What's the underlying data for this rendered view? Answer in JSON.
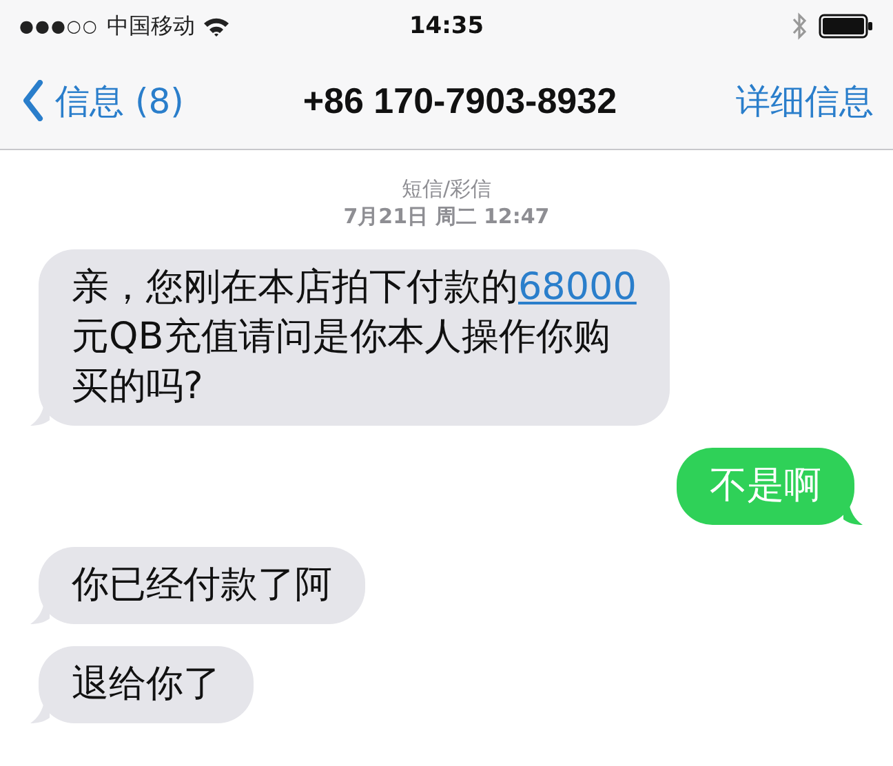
{
  "status_bar": {
    "signal": "●●●○○",
    "carrier": "中国移动",
    "time": "14:35"
  },
  "nav_bar": {
    "back": "信息 (8)",
    "title": "+86 170-7903-8932",
    "action": "详细信息"
  },
  "thread_header": {
    "service": "短信/彩信",
    "timestamp": "7月21日 周二 12:47"
  },
  "messages": [
    {
      "kind": "incoming",
      "lines": [
        [
          {
            "kind": "text",
            "text": "亲，您刚在本店拍下付款的"
          },
          {
            "kind": "link",
            "text": "68000"
          }
        ],
        [
          {
            "kind": "text",
            "text": "元QB充值请问是你本人操作你购"
          }
        ],
        [
          {
            "kind": "text",
            "text": "买的吗?"
          }
        ]
      ]
    },
    {
      "kind": "outgoing",
      "lines": [
        [
          {
            "kind": "text",
            "text": "不是啊"
          }
        ]
      ]
    },
    {
      "kind": "incoming",
      "lines": [
        [
          {
            "kind": "text",
            "text": "你已经付款了阿"
          }
        ]
      ]
    },
    {
      "kind": "incoming",
      "lines": [
        [
          {
            "kind": "text",
            "text": "退给你了"
          }
        ]
      ]
    }
  ]
}
